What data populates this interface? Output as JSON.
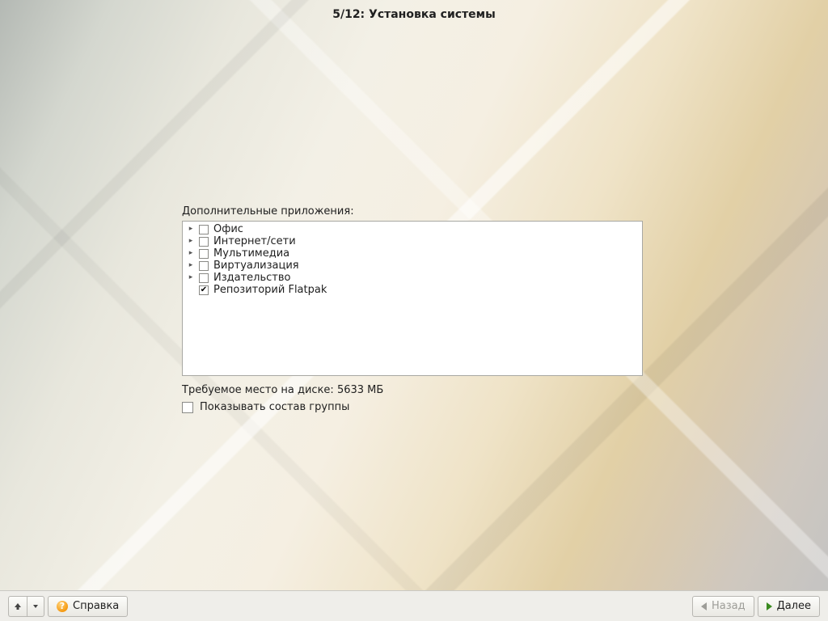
{
  "header": {
    "step": "5/12",
    "title": "Установка системы",
    "full": "5/12: Установка системы"
  },
  "section": {
    "label": "Дополнительные приложения:"
  },
  "groups": [
    {
      "label": "Офис",
      "checked": false,
      "expandable": true
    },
    {
      "label": "Интернет/сети",
      "checked": false,
      "expandable": true
    },
    {
      "label": "Мультимедиа",
      "checked": false,
      "expandable": true
    },
    {
      "label": "Виртуализация",
      "checked": false,
      "expandable": true
    },
    {
      "label": "Издательство",
      "checked": false,
      "expandable": true
    },
    {
      "label": "Репозиторий Flatpak",
      "checked": true,
      "expandable": false
    }
  ],
  "disk": {
    "label_prefix": "Требуемое место на диске: ",
    "size_mb": 5633,
    "unit": "МБ",
    "full": "Требуемое место на диске: 5633 МБ"
  },
  "show_group": {
    "checkbox_checked": false,
    "label": "Показывать состав группы"
  },
  "bottom": {
    "help": "Справка",
    "back": "Назад",
    "next": "Далее",
    "back_enabled": false,
    "next_enabled": true
  }
}
